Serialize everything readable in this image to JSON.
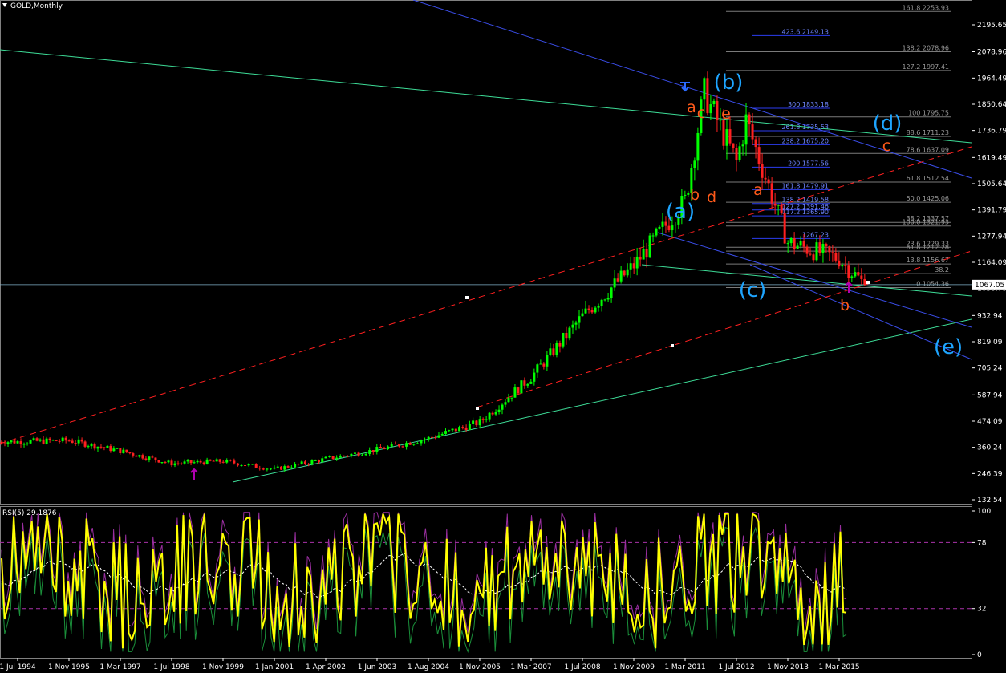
{
  "window": {
    "title": "GOLD,Monthly",
    "indicator_label": "RSI(5) 29.1876"
  },
  "colors": {
    "background": "#000000",
    "bull_candle": "#00ff00",
    "bear_candle": "#ff2020",
    "wick": "#b0b0b0",
    "axis_text": "#ffffff",
    "fib_blue": "#2b3df0",
    "fib_gray": "#7a7a7a",
    "channel_blue": "#3a4de8",
    "trend_green": "#3ddc97",
    "red_dashed": "#ff2020",
    "wave_blue": "#1ea5ff",
    "wave_orange": "#ff5a1a",
    "rsi_line": "#ffff00",
    "rsi_signal": "#ffffff",
    "rsi_level": "#aa33aa",
    "price_marker_bg": "#ffffff"
  },
  "chart_data": [
    {
      "type": "candlestick",
      "title": "GOLD,Monthly",
      "price_axis_ticks": [
        "2195.65",
        "2078.96",
        "1964.49",
        "1850.64",
        "1736.79",
        "1619.49",
        "1505.64",
        "1391.79",
        "1277.94",
        "1164.09",
        "1050.79",
        "932.94",
        "819.09",
        "705.24",
        "587.94",
        "474.09",
        "360.24",
        "246.39",
        "132.54"
      ],
      "current_price": "1067.05",
      "time_axis_ticks": [
        "1 Jul 1994",
        "1 Nov 1995",
        "1 Mar 1997",
        "1 Jul 1998",
        "1 Nov 1999",
        "1 Jan 2001",
        "1 Apr 2002",
        "1 Jun 2003",
        "1 Aug 2004",
        "1 Nov 2005",
        "1 Mar 2007",
        "1 Jul 2008",
        "1 Nov 2009",
        "1 Mar 2011",
        "1 Jul 2012",
        "1 Nov 2013",
        "1 Mar 2015"
      ],
      "ylim": [
        132.54,
        2253.93
      ],
      "key_points": [
        {
          "date": "1 Jul 1994",
          "price": 385
        },
        {
          "date": "1 Nov 1995",
          "price": 390
        },
        {
          "date": "1 Mar 1997",
          "price": 345
        },
        {
          "date": "1 Jul 1998",
          "price": 290
        },
        {
          "date": "1 Nov 1999",
          "price": 300
        },
        {
          "date": "1 Jan 2001",
          "price": 265
        },
        {
          "date": "1 Apr 2002",
          "price": 310
        },
        {
          "date": "1 Jun 2003",
          "price": 350
        },
        {
          "date": "1 Aug 2004",
          "price": 400
        },
        {
          "date": "1 Nov 2005",
          "price": 470
        },
        {
          "date": "1 Mar 2007",
          "price": 665
        },
        {
          "date": "1 Jul 2008",
          "price": 930
        },
        {
          "date": "1 Nov 2009",
          "price": 1150
        },
        {
          "date": "1 Mar 2011",
          "price": 1430
        },
        {
          "date": "1 Sep 2011",
          "price": 1900
        },
        {
          "date": "1 Jul 2012",
          "price": 1600
        },
        {
          "date": "1 Oct 2012",
          "price": 1780
        },
        {
          "date": "1 Nov 2013",
          "price": 1250
        },
        {
          "date": "1 Mar 2015",
          "price": 1180
        },
        {
          "date": "1 Nov 2015",
          "price": 1067
        }
      ],
      "fib_levels": [
        {
          "label": "161.8 2253.93",
          "color": "gray"
        },
        {
          "label": "423.6 2149.13",
          "color": "blue"
        },
        {
          "label": "138.2 2078.96",
          "color": "gray"
        },
        {
          "label": "127.2 1997.41",
          "color": "gray"
        },
        {
          "label": "300 1833.18",
          "color": "blue"
        },
        {
          "label": "100 1795.75",
          "color": "gray"
        },
        {
          "label": "261.8 1735.53",
          "color": "blue"
        },
        {
          "label": "88.6 1711.23",
          "color": "gray"
        },
        {
          "label": "238.2 1675.20",
          "color": "blue"
        },
        {
          "label": "78.6 1637.09",
          "color": "gray"
        },
        {
          "label": "200 1577.56",
          "color": "blue"
        },
        {
          "label": "61.8 1512.54",
          "color": "gray"
        },
        {
          "label": "161.8 1479.91",
          "color": "blue"
        },
        {
          "label": "50.0 1425.06",
          "color": "gray"
        },
        {
          "label": "138.2 1419.58",
          "color": "blue"
        },
        {
          "label": "127.2 1391.46",
          "color": "blue"
        },
        {
          "label": "117.2 1365.90",
          "color": "blue"
        },
        {
          "label": "38.2 1337.57",
          "color": "gray"
        },
        {
          "label": "100.0 1321.93",
          "color": "gray"
        },
        {
          "label": "1267.23",
          "color": "blue"
        },
        {
          "label": "23.6 1229.33",
          "color": "gray"
        },
        {
          "label": "61.8 1212.28",
          "color": "gray"
        },
        {
          "label": "13.8 1156.67",
          "color": "gray"
        },
        {
          "label": "38.2",
          "color": "gray"
        },
        {
          "label": "0 1054.36",
          "color": "gray"
        }
      ],
      "wave_labels": [
        {
          "text": "(a)",
          "color": "blue"
        },
        {
          "text": "(b)",
          "color": "blue"
        },
        {
          "text": "(c)",
          "color": "blue"
        },
        {
          "text": "(d)",
          "color": "blue"
        },
        {
          "text": "(e)",
          "color": "blue"
        },
        {
          "text": "a",
          "color": "orange"
        },
        {
          "text": "c",
          "color": "orange"
        },
        {
          "text": "e",
          "color": "orange"
        },
        {
          "text": "b",
          "color": "orange"
        },
        {
          "text": "d",
          "color": "orange"
        },
        {
          "text": "a",
          "color": "orange"
        },
        {
          "text": "c",
          "color": "orange"
        },
        {
          "text": "b",
          "color": "orange"
        }
      ]
    },
    {
      "type": "line",
      "title": "RSI(5) 29.1876",
      "ylim": [
        0,
        100
      ],
      "axis_ticks": [
        "100",
        "78",
        "32",
        "0"
      ],
      "levels": [
        78,
        32
      ],
      "last_value": 29.1876
    }
  ]
}
